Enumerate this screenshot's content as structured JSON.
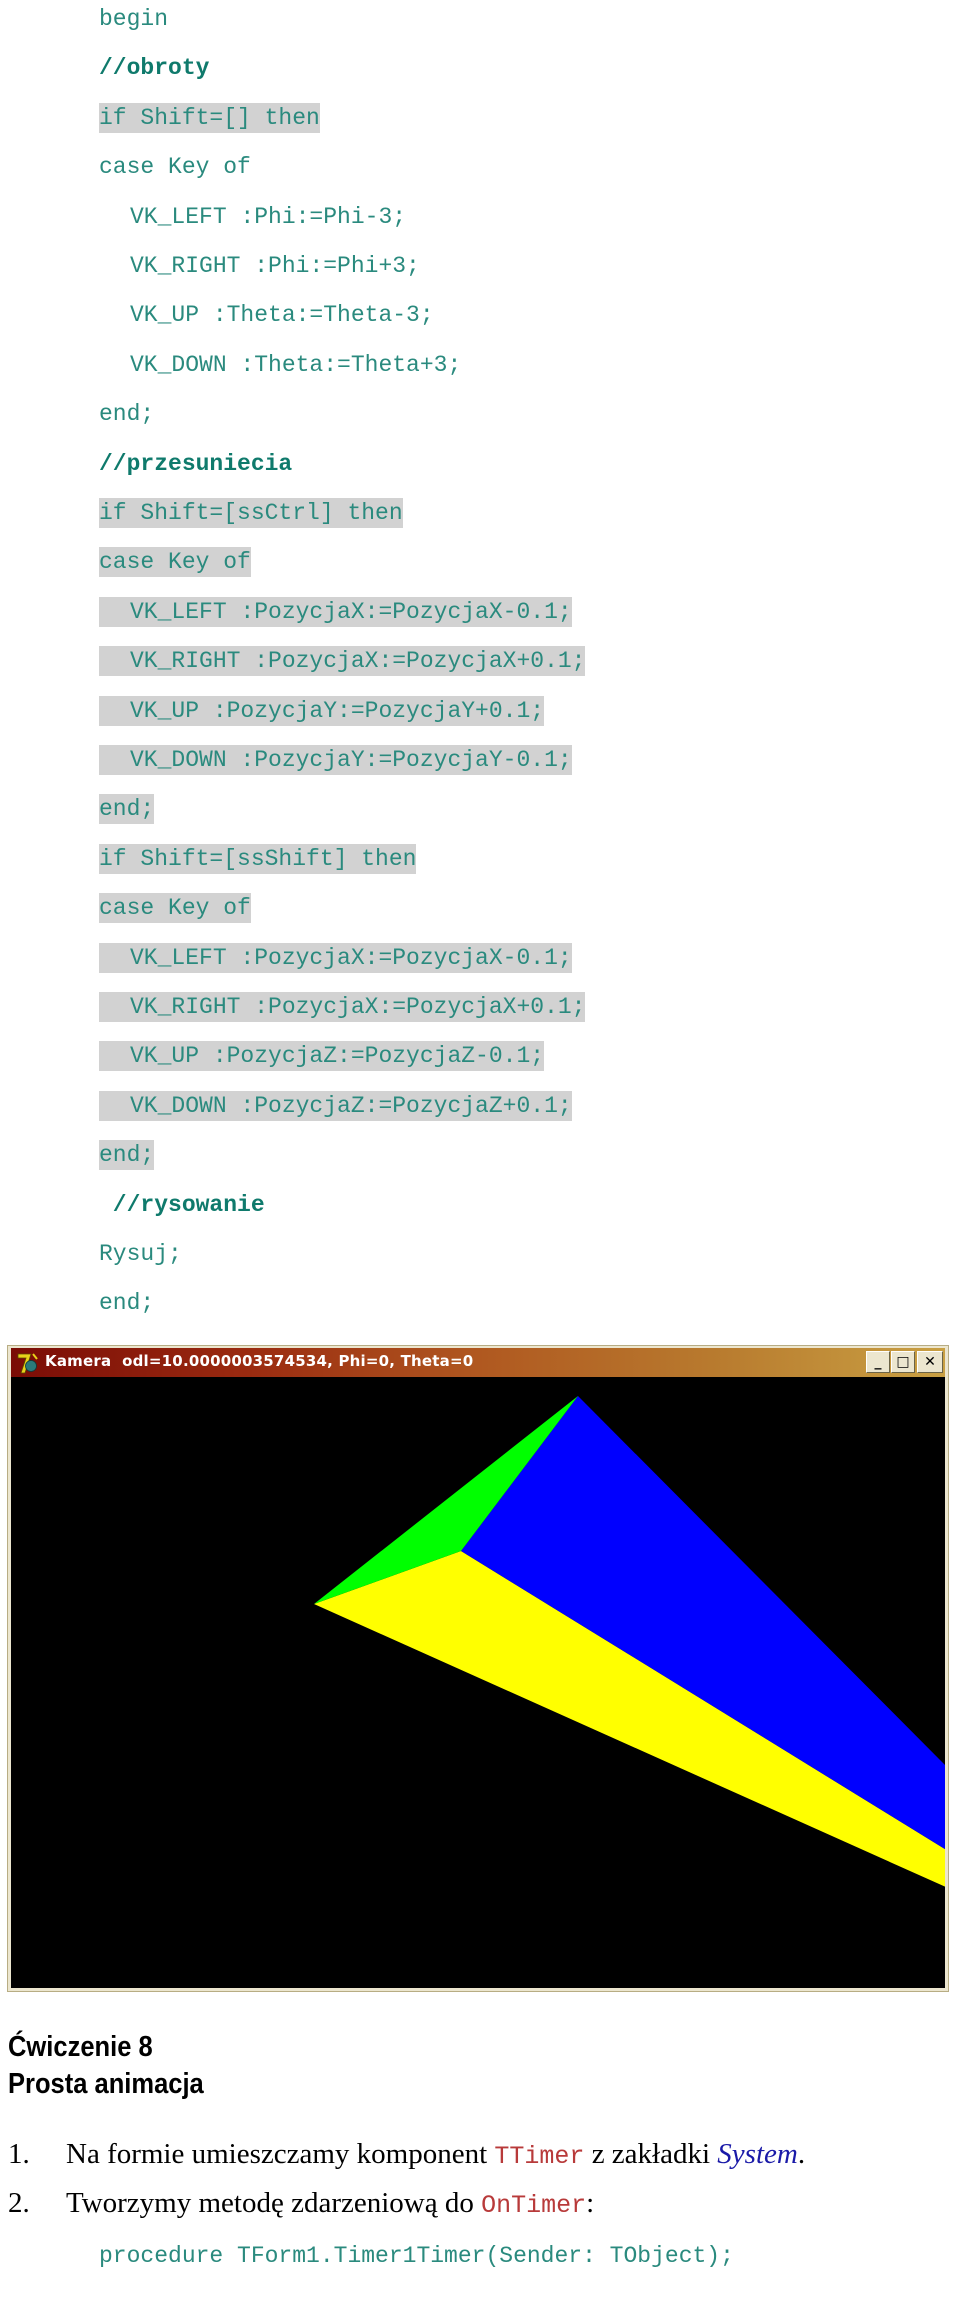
{
  "code_top": {
    "lines": [
      {
        "text": "begin",
        "style": "normal"
      },
      {
        "text": "//obroty",
        "style": "comment"
      },
      {
        "text": "if Shift=[] then",
        "style": "highlight"
      },
      {
        "text": "case Key of",
        "style": "normal"
      },
      {
        "text": "VK_LEFT :Phi:=Phi-3;",
        "style": "normal",
        "indent": 1
      },
      {
        "text": "VK_RIGHT :Phi:=Phi+3;",
        "style": "normal",
        "indent": 1
      },
      {
        "text": "VK_UP :Theta:=Theta-3;",
        "style": "normal",
        "indent": 1
      },
      {
        "text": "VK_DOWN :Theta:=Theta+3;",
        "style": "normal",
        "indent": 1
      },
      {
        "text": "end;",
        "style": "normal"
      },
      {
        "text": "//przesuniecia",
        "style": "comment"
      },
      {
        "text": "if Shift=[ssCtrl] then",
        "style": "highlight"
      },
      {
        "text": "case Key of",
        "style": "highlight"
      },
      {
        "text": "VK_LEFT :PozycjaX:=PozycjaX-0.1;",
        "style": "highlight",
        "indent": 1
      },
      {
        "text": "VK_RIGHT :PozycjaX:=PozycjaX+0.1;",
        "style": "highlight",
        "indent": 1
      },
      {
        "text": "VK_UP :PozycjaY:=PozycjaY+0.1;",
        "style": "highlight",
        "indent": 1
      },
      {
        "text": "VK_DOWN :PozycjaY:=PozycjaY-0.1;",
        "style": "highlight",
        "indent": 1
      },
      {
        "text": "end;",
        "style": "highlight"
      },
      {
        "text": "if Shift=[ssShift] then",
        "style": "highlight"
      },
      {
        "text": "case Key of",
        "style": "highlight"
      },
      {
        "text": "VK_LEFT :PozycjaX:=PozycjaX-0.1;",
        "style": "highlight",
        "indent": 1
      },
      {
        "text": "VK_RIGHT :PozycjaX:=PozycjaX+0.1;",
        "style": "highlight",
        "indent": 1
      },
      {
        "text": "VK_UP :PozycjaZ:=PozycjaZ-0.1;",
        "style": "highlight",
        "indent": 1
      },
      {
        "text": "VK_DOWN :PozycjaZ:=PozycjaZ+0.1;",
        "style": "highlight",
        "indent": 1
      },
      {
        "text": "end;",
        "style": "highlight"
      },
      {
        "text": " //rysowanie",
        "style": "comment"
      },
      {
        "text": "Rysuj;",
        "style": "normal"
      },
      {
        "text": "end;",
        "style": "normal"
      }
    ]
  },
  "window": {
    "title": "Kamera  odl=10.0000003574534, Phi=0, Theta=0",
    "icon": "delphi-app-icon",
    "buttons": {
      "minimize": "_",
      "maximize": "□",
      "close": "✕"
    },
    "scene": {
      "background": "#000000",
      "faces": [
        {
          "name": "green-face",
          "color": "#00ff00"
        },
        {
          "name": "blue-face",
          "color": "#0000ff"
        },
        {
          "name": "yellow-face",
          "color": "#ffff00"
        }
      ]
    }
  },
  "section": {
    "title": "Ćwiczenie 8",
    "subtitle": "Prosta animacja"
  },
  "steps": [
    {
      "number": "1.",
      "parts": [
        {
          "text": "Na formie umieszczamy komponent ",
          "style": "plain"
        },
        {
          "text": "TTimer",
          "style": "code"
        },
        {
          "text": " z zakładki ",
          "style": "plain"
        },
        {
          "text": "System",
          "style": "italic-link"
        },
        {
          "text": ".",
          "style": "plain"
        }
      ]
    },
    {
      "number": "2.",
      "parts": [
        {
          "text": "Tworzymy metodę zdarzeniową do ",
          "style": "plain"
        },
        {
          "text": "OnTimer",
          "style": "code"
        },
        {
          "text": ":",
          "style": "plain"
        }
      ]
    }
  ],
  "code_bottom": {
    "lines": [
      {
        "text": "procedure TForm1.Timer1Timer(Sender: TObject);",
        "style": "normal"
      }
    ]
  },
  "colors": {
    "code_text": "#2a8a7e",
    "code_comment": "#0f7a6c",
    "code_highlight": "#d2d2d2",
    "inline_code": "#b83a3a",
    "link": "#1a1aa8"
  }
}
